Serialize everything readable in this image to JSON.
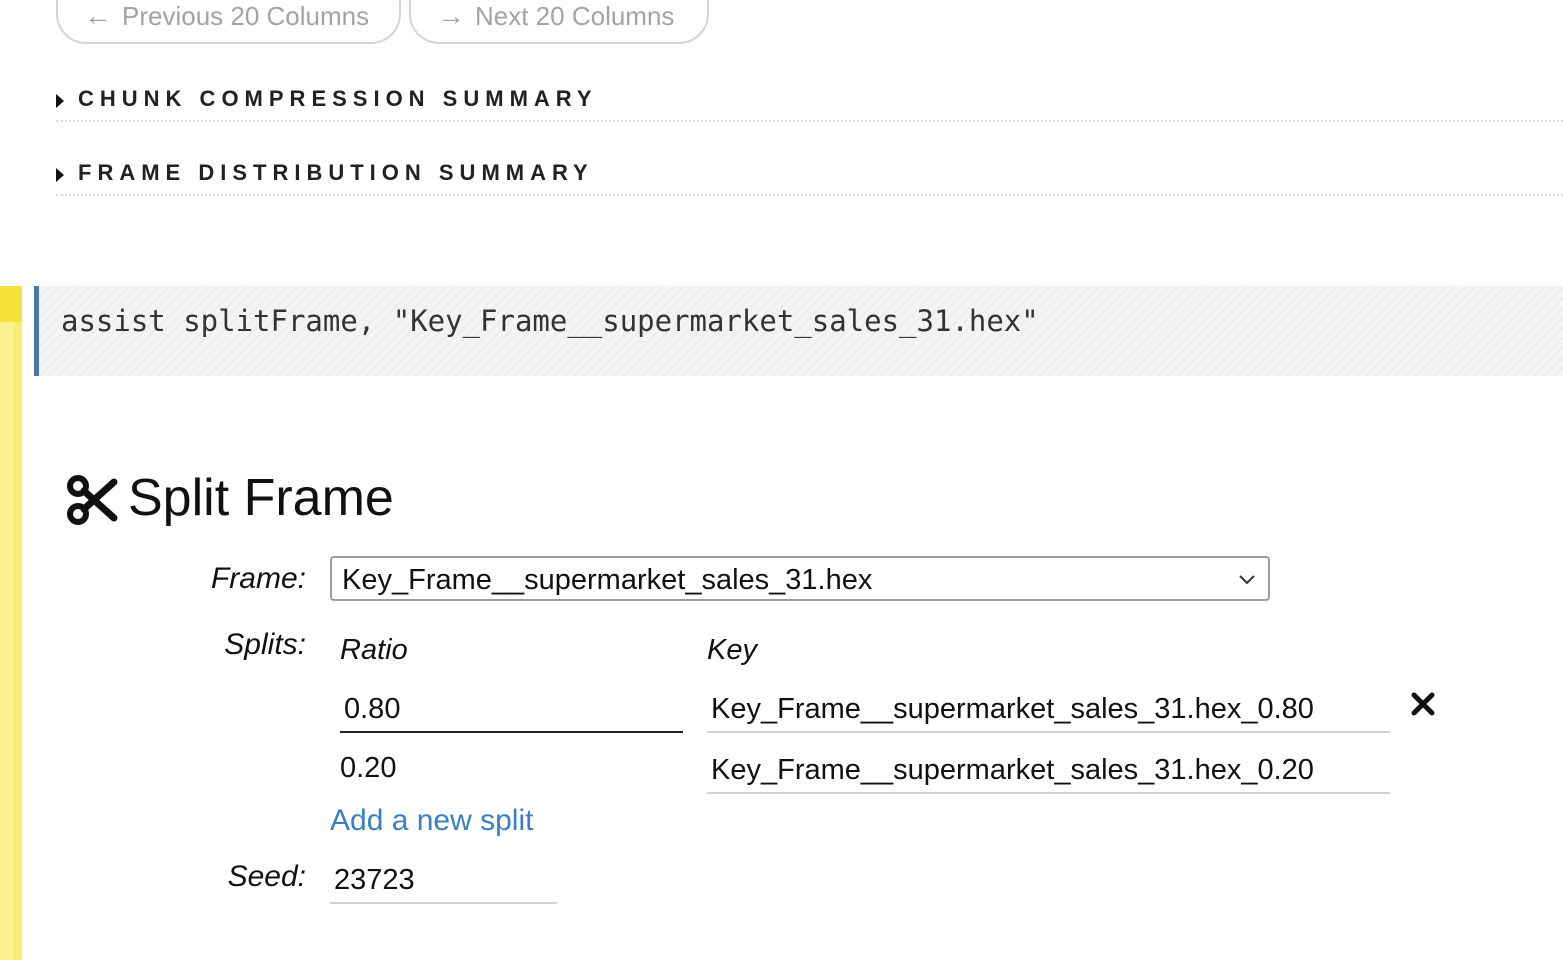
{
  "pager": {
    "previous_label": "Previous 20 Columns",
    "next_label": "Next 20 Columns",
    "previous_icon": "arrow-left-icon",
    "next_icon": "arrow-right-icon"
  },
  "summaries": [
    {
      "label": "CHUNK COMPRESSION SUMMARY"
    },
    {
      "label": "FRAME DISTRIBUTION SUMMARY"
    }
  ],
  "code_cell": {
    "code": "assist splitFrame, \"Key_Frame__supermarket_sales_31.hex\"",
    "accent_color": "#4a76aa"
  },
  "split_frame": {
    "title": "Split Frame",
    "title_icon": "scissors-icon",
    "frame_label": "Frame:",
    "frame_value": "Key_Frame__supermarket_sales_31.hex",
    "splits_label": "Splits:",
    "ratio_header": "Ratio",
    "key_header": "Key",
    "splits": [
      {
        "ratio": "0.80",
        "key": "Key_Frame__supermarket_sales_31.hex_0.80",
        "removable": true
      },
      {
        "ratio": "0.20",
        "key": "Key_Frame__supermarket_sales_31.hex_0.20",
        "removable": false
      }
    ],
    "add_split_label": "Add a new split",
    "seed_label": "Seed:",
    "seed_value": "23723",
    "link_color": "#3a80c0"
  }
}
